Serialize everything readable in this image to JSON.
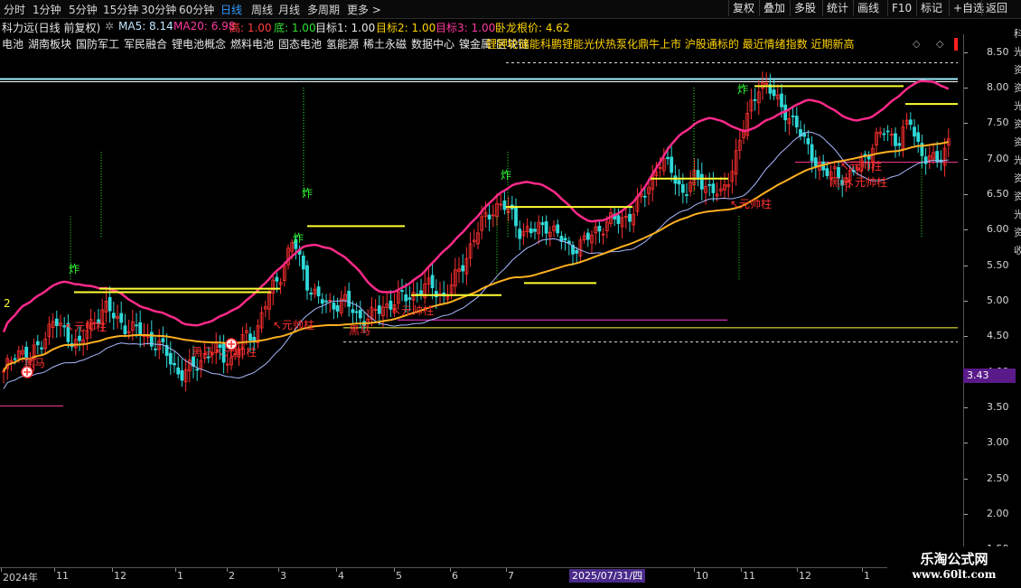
{
  "periods": [
    "分时",
    "1分钟",
    "5分钟",
    "15分钟",
    "30分钟",
    "60分钟",
    "日线",
    "周线",
    "月线",
    "多周期",
    "更多 >"
  ],
  "active_period": "日线",
  "right_buttons": [
    "复权",
    "叠加",
    "多股",
    "统计",
    "画线",
    "F10",
    "标记",
    "+自选",
    "返回"
  ],
  "stock": {
    "name": "科力远(日线 前复权)"
  },
  "indicators": {
    "ma5": "MA5: 8.14",
    "ma20": "MA20: 6.98",
    "high": "高: 1.00",
    "bottom": "底: 1.00",
    "target1": "目标1: 1.00",
    "target2": "目标2: 1.00",
    "target3": "目标3: 1.00",
    "wolong": "卧龙根价: 4.62"
  },
  "concepts": [
    "电池",
    "湖南板块",
    "国防军工",
    "军民融合",
    "锂电池概念",
    "燃料电池",
    "固态电池",
    "氢能源",
    "稀土永磁",
    "数据中心",
    "镍金属",
    "区块链"
  ],
  "concepts_overlap": "锂钾轮储能科鹏锂能光伏热泵化鼎牛上市 沪股通标的 最近情绪指数 近期新高",
  "price_axis": [
    "8.50",
    "8.00",
    "7.50",
    "7.00",
    "6.50",
    "6.00",
    "5.50",
    "5.00",
    "4.50",
    "4.00",
    "3.50",
    "3.00",
    "2.50",
    "2.00",
    "1.50"
  ],
  "current_price": "3.43",
  "time_axis": [
    "2024年",
    "11",
    "12",
    "1",
    "2",
    "3",
    "4",
    "5",
    "6",
    "7",
    "10",
    "11",
    "12",
    "1"
  ],
  "cursor_date": "2025/07/31/四",
  "chart_labels": {
    "zha": "炸",
    "yuanshuai": "元帅柱",
    "heima": "黑马",
    "num2": "2"
  },
  "side_text": "科 光 资 资 光 资 资 光 资 资 光 资 收",
  "watermark": {
    "line1": "乐淘公式网",
    "line2": "www.60lt.com"
  },
  "chart_data": {
    "type": "candlestick",
    "ylim": [
      1.25,
      8.75
    ],
    "major_levels": [
      8.12,
      4.62
    ],
    "close_path": [
      3.95,
      4.35,
      4.15,
      4.45,
      4.7,
      4.55,
      4.35,
      4.7,
      4.9,
      4.75,
      4.6,
      4.55,
      4.4,
      4.25,
      3.95,
      4.05,
      4.25,
      4.3,
      4.15,
      4.45,
      4.55,
      5.05,
      5.4,
      5.85,
      5.3,
      5.0,
      4.95,
      5.0,
      4.8,
      4.75,
      4.9,
      5.0,
      5.05,
      5.15,
      5.2,
      5.05,
      5.35,
      5.75,
      6.1,
      6.35,
      6.3,
      6.0,
      5.95,
      6.1,
      5.9,
      5.75,
      5.8,
      6.0,
      6.1,
      6.15,
      6.25,
      6.55,
      6.95,
      6.85,
      6.5,
      6.75,
      6.6,
      6.45,
      7.0,
      7.55,
      8.1,
      7.9,
      7.7,
      7.4,
      7.15,
      6.75,
      6.85,
      6.65,
      7.0,
      7.15,
      7.45,
      7.2,
      7.55,
      7.0,
      6.95,
      7.25
    ]
  }
}
